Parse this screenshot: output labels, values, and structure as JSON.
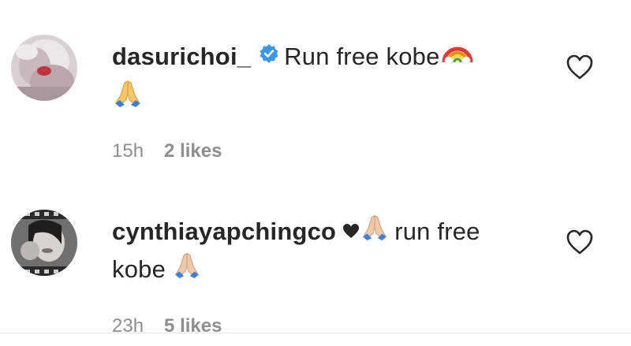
{
  "comments": [
    {
      "username": "dasurichoi_",
      "verified": true,
      "text_line1": "Run free kobe",
      "text_line2_icon": "folded-hands-emoji",
      "icon_after_line1": "rainbow-emoji",
      "time": "15h",
      "likes": "2 likes"
    },
    {
      "username": "cynthiayapchingco",
      "verified": false,
      "text_line1": "run free",
      "text_line2": "kobe",
      "icon_after_username": [
        "black-heart-emoji",
        "folded-hands-emoji"
      ],
      "icon_after_line2": "folded-hands-emoji",
      "time": "23h",
      "likes": "5 likes"
    }
  ],
  "colors": {
    "text": "#262626",
    "meta": "#8e8e8e",
    "verified": "#3897f0"
  }
}
